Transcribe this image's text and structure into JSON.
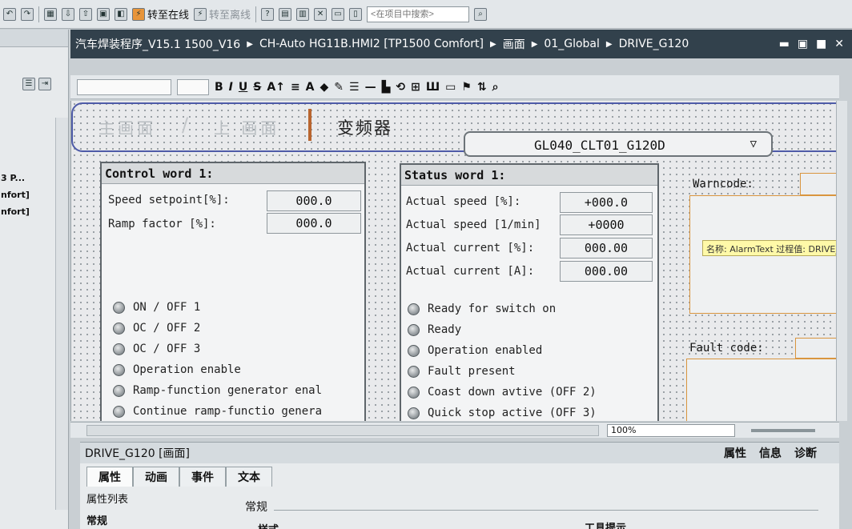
{
  "toolbar": {
    "go_online": "转至在线",
    "go_offline": "转至离线",
    "search_placeholder": "<在项目中搜索>"
  },
  "left_pane": {
    "items": [
      "3 P...",
      "nfort]",
      "nfort]"
    ]
  },
  "breadcrumb": {
    "project": "汽车焊装程序_V15.1 1500_V16",
    "device": "CH-Auto HG11B.HMI2 [TP1500 Comfort]",
    "folder1": "画面",
    "folder2": "01_Global",
    "screen": "DRIVE_G120"
  },
  "format_toolbar": {
    "bold": "B",
    "italic": "I",
    "underline": "U",
    "strike": "S"
  },
  "hmi": {
    "nav_main": "主画面",
    "nav_slash": "/",
    "nav_prev": "上 画面",
    "screen_title": "变频器",
    "device_selected": "GL040_CLT01_G120D",
    "control_word": {
      "title": "Control word 1:",
      "rows": [
        {
          "label": "Speed setpoint[%]:",
          "value": "000.0"
        },
        {
          "label": "Ramp factor [%]:",
          "value": "000.0"
        }
      ],
      "bits": [
        "ON / OFF 1",
        "OC / OFF 2",
        "OC / OFF 3",
        "Operation enable",
        "Ramp-function generator enal",
        "Continue ramp-functio genera"
      ]
    },
    "status_word": {
      "title": "Status word 1:",
      "rows": [
        {
          "label": "Actual speed [%]:",
          "value": "+000.0"
        },
        {
          "label": "Actual speed [1/min]",
          "value": "+0000"
        },
        {
          "label": "Actual current [%]:",
          "value": "000.00"
        },
        {
          "label": "Actual current [A]:",
          "value": "000.00"
        }
      ],
      "bits": [
        "Ready for switch on",
        "Ready",
        "Operation enabled",
        "Fault present",
        "Coast down avtive (OFF 2)",
        "Quick stop active (OFF 3)"
      ]
    },
    "warncode_label": "Warncode:",
    "fault_label": "Fault code:",
    "alarm_tooltip": "名称: AlarmText 过程值: DRIVE_H"
  },
  "status_strip": {
    "zoom": "100%"
  },
  "inspector": {
    "title": "DRIVE_G120 [画面]",
    "right_tabs": [
      "属性",
      "信息",
      "诊断"
    ],
    "tabs": [
      "属性",
      "动画",
      "事件",
      "文本"
    ],
    "prop_list": "属性列表",
    "prop_general": "常规",
    "section_general": "常规",
    "col_style": "样式",
    "col_tooltip": "工具提示"
  }
}
